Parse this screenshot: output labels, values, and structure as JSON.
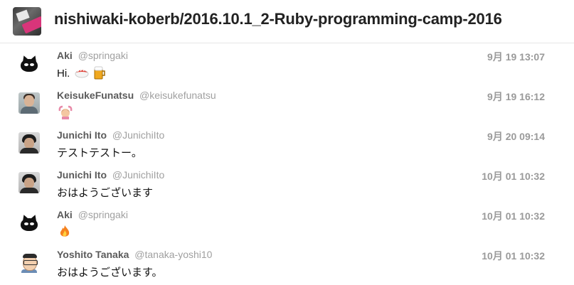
{
  "room": {
    "title": "nishiwaki-koberb/2016.10.1_2-Ruby-programming-camp-2016",
    "avatar_icon": "room-avatar-image"
  },
  "messages": [
    {
      "name": "Aki",
      "handle": "@springaki",
      "time": "9月 19 13:07",
      "text": "Hi.",
      "emojis": [
        "sushi",
        "beer"
      ],
      "avatar": "cat-avatar"
    },
    {
      "name": "KeisukeFunatsu",
      "handle": "@keisukefunatsu",
      "time": "9月 19 16:12",
      "text": "",
      "emojis": [
        "person-gesturing-ok"
      ],
      "avatar": "photo-avatar"
    },
    {
      "name": "Junichi Ito",
      "handle": "@JunichiIto",
      "time": "9月 20 09:14",
      "text": "テストテストー。",
      "emojis": [],
      "avatar": "photo-avatar"
    },
    {
      "name": "Junichi Ito",
      "handle": "@JunichiIto",
      "time": "10月 01 10:32",
      "text": "おはようございます",
      "emojis": [],
      "avatar": "photo-avatar"
    },
    {
      "name": "Aki",
      "handle": "@springaki",
      "time": "10月 01 10:32",
      "text": "",
      "emojis": [
        "fire"
      ],
      "avatar": "cat-avatar"
    },
    {
      "name": "Yoshito Tanaka",
      "handle": "@tanaka-yoshi10",
      "time": "10月 01 10:32",
      "text": "おはようございます。",
      "emojis": [],
      "avatar": "illustration-avatar"
    }
  ]
}
